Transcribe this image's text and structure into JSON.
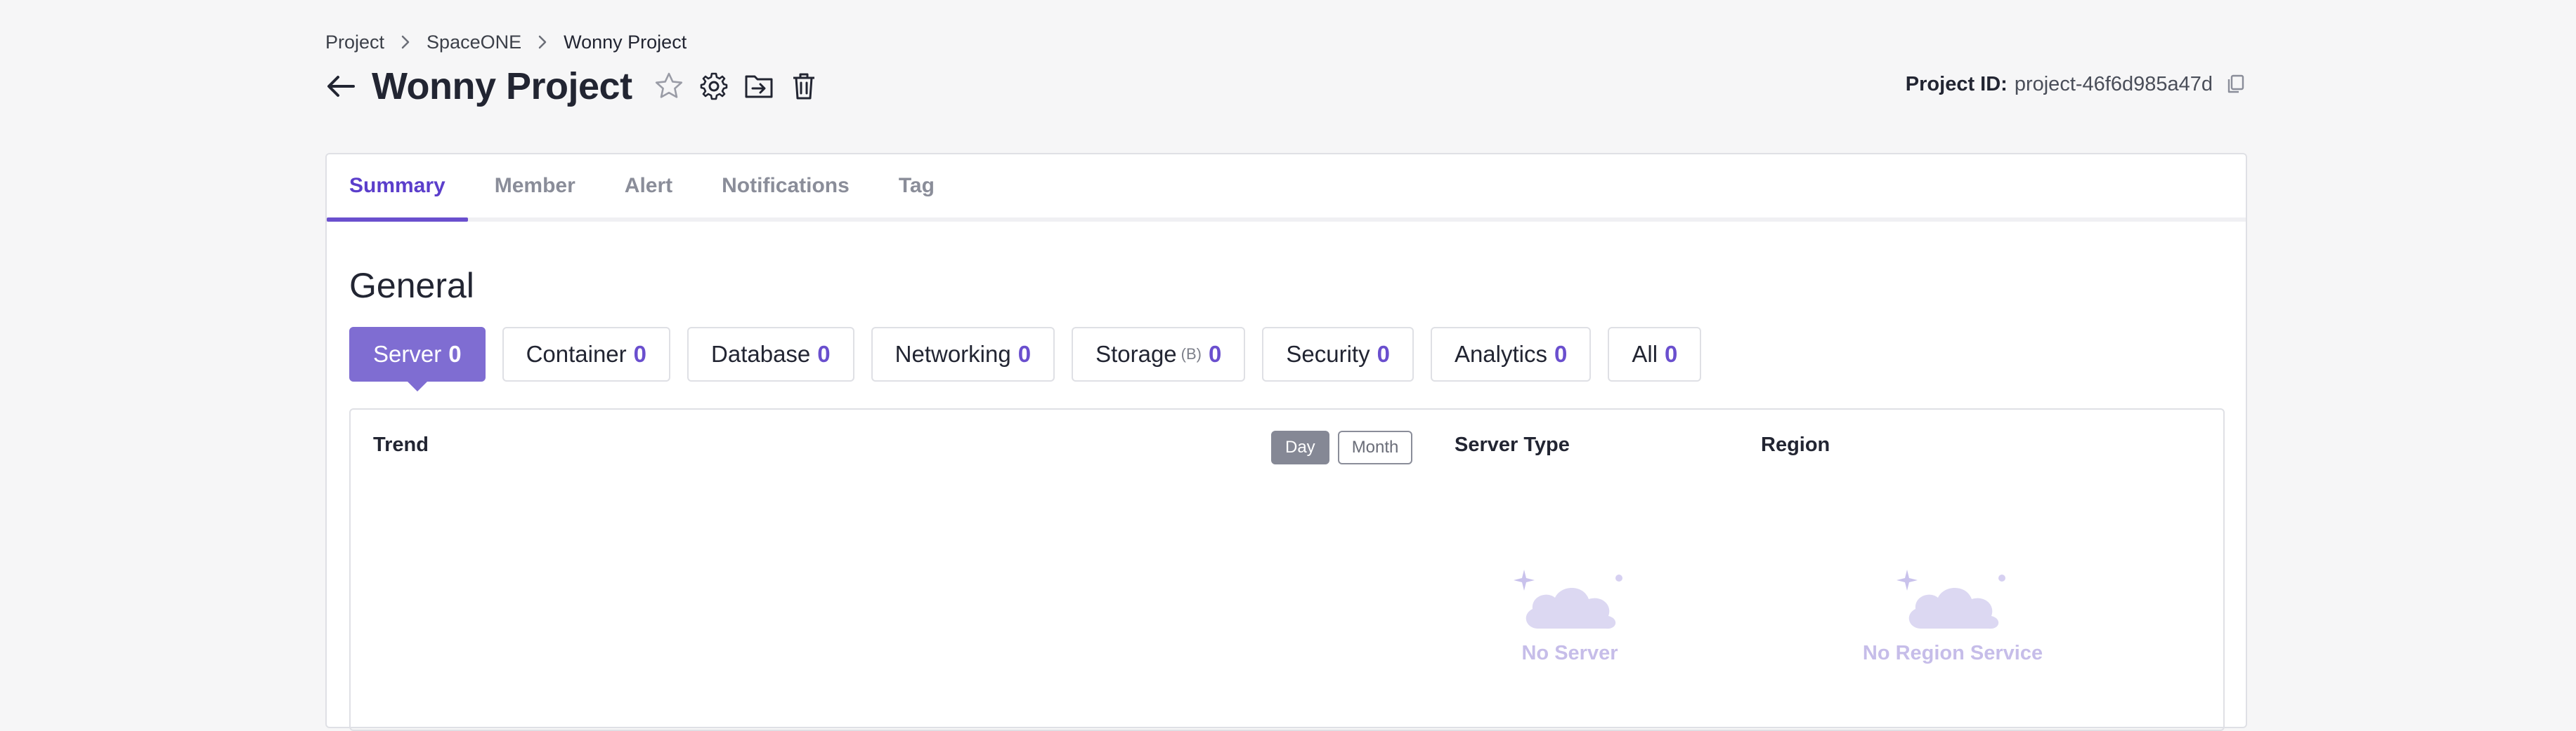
{
  "breadcrumb": [
    {
      "label": "Project"
    },
    {
      "label": "SpaceONE"
    },
    {
      "label": "Wonny Project"
    }
  ],
  "header": {
    "title": "Wonny Project",
    "project_id_label": "Project ID:",
    "project_id_value": "project-46f6d985a47d"
  },
  "tabs": [
    {
      "label": "Summary",
      "active": true
    },
    {
      "label": "Member"
    },
    {
      "label": "Alert"
    },
    {
      "label": "Notifications"
    },
    {
      "label": "Tag"
    }
  ],
  "general": {
    "title": "General",
    "categories": [
      {
        "label": "Server",
        "count": "0",
        "active": true
      },
      {
        "label": "Container",
        "count": "0"
      },
      {
        "label": "Database",
        "count": "0"
      },
      {
        "label": "Networking",
        "count": "0"
      },
      {
        "label": "Storage",
        "badge": "(B)",
        "count": "0"
      },
      {
        "label": "Security",
        "count": "0"
      },
      {
        "label": "Analytics",
        "count": "0"
      },
      {
        "label": "All",
        "count": "0"
      }
    ]
  },
  "panel": {
    "trend_title": "Trend",
    "toggle_day": "Day",
    "toggle_month": "Month",
    "server_type_title": "Server Type",
    "region_title": "Region",
    "empty_server": "No Server",
    "empty_region": "No Region Service"
  },
  "colors": {
    "accent": "#6a4fce",
    "active_chip": "#7f6dd2",
    "empty_text": "#c6bde9",
    "background": "#f6f6f7"
  },
  "icons": [
    "chevron-right-icon",
    "arrow-left-icon",
    "star-icon",
    "gear-icon",
    "folder-move-icon",
    "trash-icon",
    "copy-icon",
    "cloud-icon"
  ]
}
